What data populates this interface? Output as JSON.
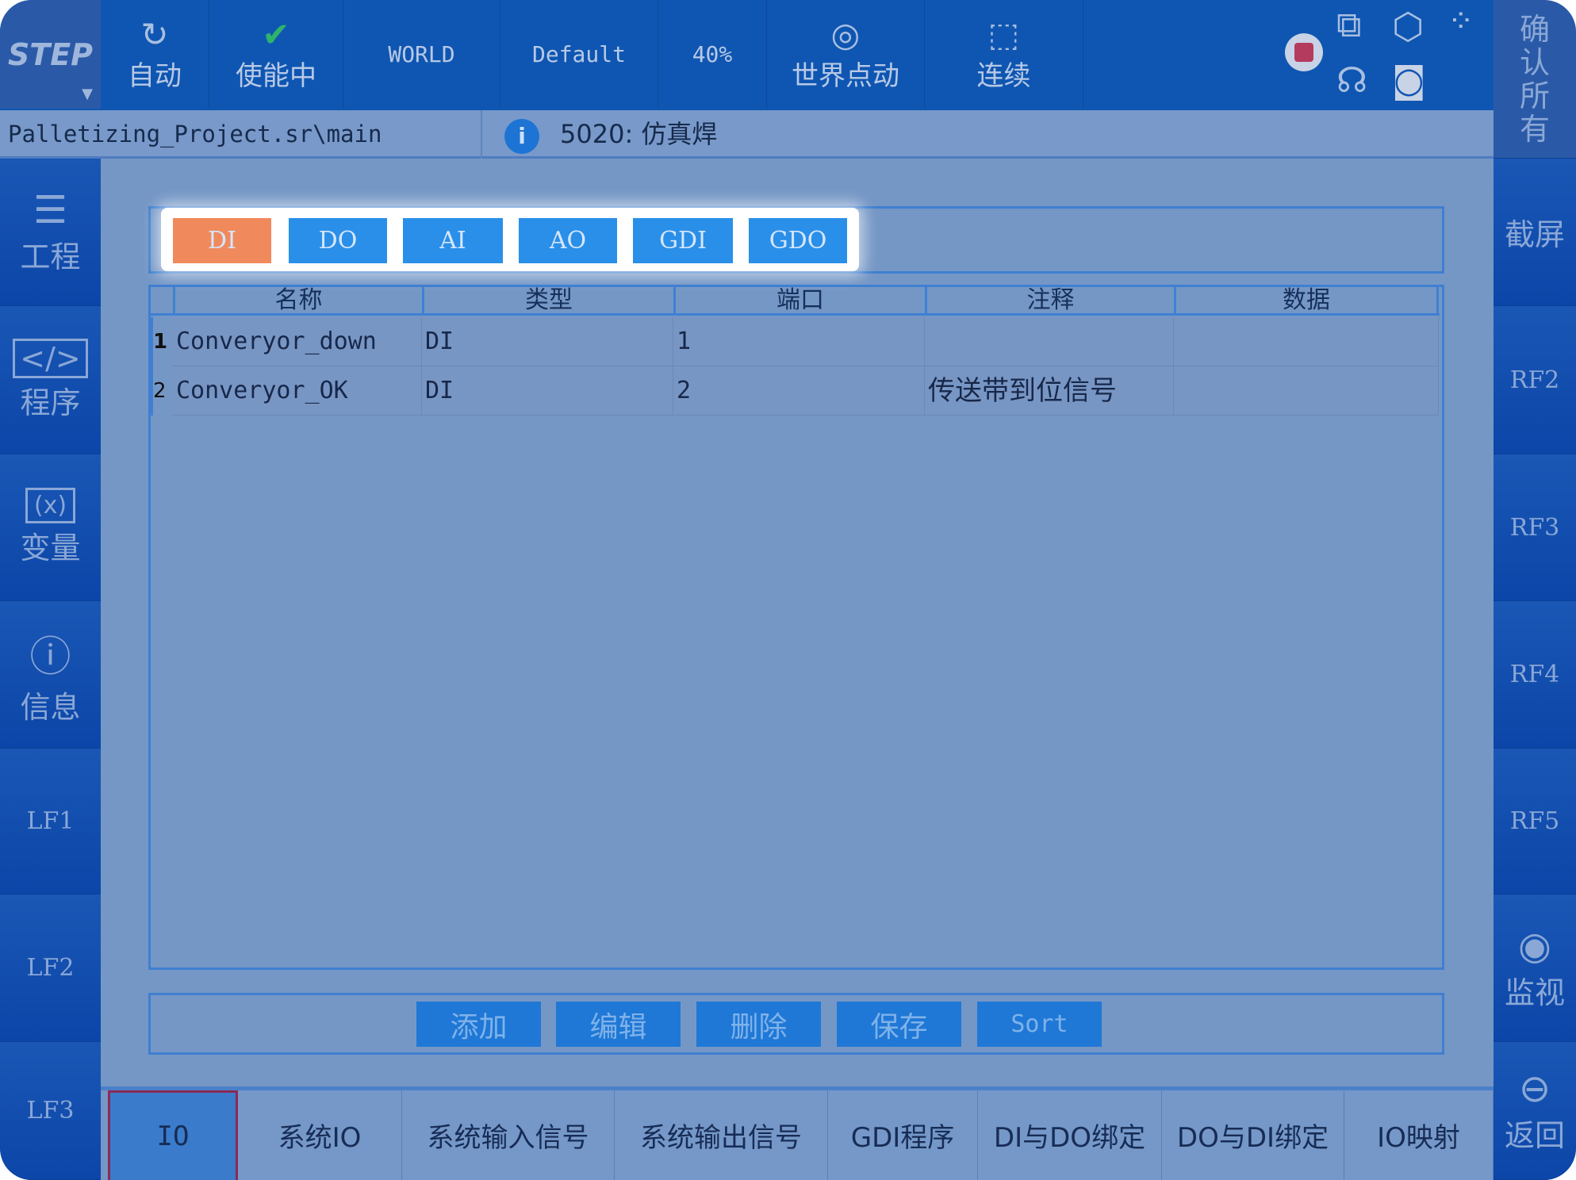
{
  "header": {
    "mode_logo": "STEP",
    "buttons": [
      {
        "label": "自动",
        "icon": "auto-rotate-icon"
      },
      {
        "label": "使能中",
        "icon": "robot-enable-icon"
      },
      {
        "label": "WORLD"
      },
      {
        "label": "Default"
      },
      {
        "label": "40%"
      },
      {
        "label": "世界点动",
        "icon": "globe-icon"
      },
      {
        "label": "连续",
        "icon": "continuous-icon"
      }
    ],
    "confirm_all": "确认所有"
  },
  "path": "Palletizing_Project.sr\\main",
  "message": {
    "code": "5020:",
    "text": "仿真焊"
  },
  "left_sidebar": [
    {
      "label": "工程",
      "icon": "list-icon"
    },
    {
      "label": "程序",
      "icon": "code-icon"
    },
    {
      "label": "变量",
      "icon": "variable-icon"
    },
    {
      "label": "信息",
      "icon": "info-icon"
    },
    {
      "label": "LF1"
    },
    {
      "label": "LF2"
    },
    {
      "label": "LF3"
    }
  ],
  "right_sidebar": [
    {
      "label": "截屏"
    },
    {
      "label": "RF2"
    },
    {
      "label": "RF3"
    },
    {
      "label": "RF4"
    },
    {
      "label": "RF5"
    },
    {
      "label": "监视",
      "icon": "eye-icon"
    },
    {
      "label": "返回",
      "icon": "back-arrow-icon"
    }
  ],
  "io_tabs": [
    "DI",
    "DO",
    "AI",
    "AO",
    "GDI",
    "GDO"
  ],
  "active_io_tab": "DI",
  "table": {
    "columns": [
      "名称",
      "类型",
      "端口",
      "注释",
      "数据"
    ],
    "rows": [
      {
        "index": "1",
        "cells": [
          "Converyor_down",
          "DI",
          "1",
          "",
          ""
        ]
      },
      {
        "index": "2",
        "cells": [
          "Converyor_OK",
          "DI",
          "2",
          "传送带到位信号",
          ""
        ]
      }
    ]
  },
  "actions": [
    "添加",
    "编辑",
    "删除",
    "保存",
    "Sort"
  ],
  "bottom_tabs": [
    "IO",
    "系统IO",
    "系统输入信号",
    "系统输出信号",
    "GDI程序",
    "DI与DO绑定",
    "DO与DI绑定",
    "IO映射"
  ],
  "active_bottom_tab": "IO",
  "colors": {
    "active_tab": "#f08a5d",
    "tab": "#2a8fe8",
    "topbar": "#0f56b2"
  }
}
